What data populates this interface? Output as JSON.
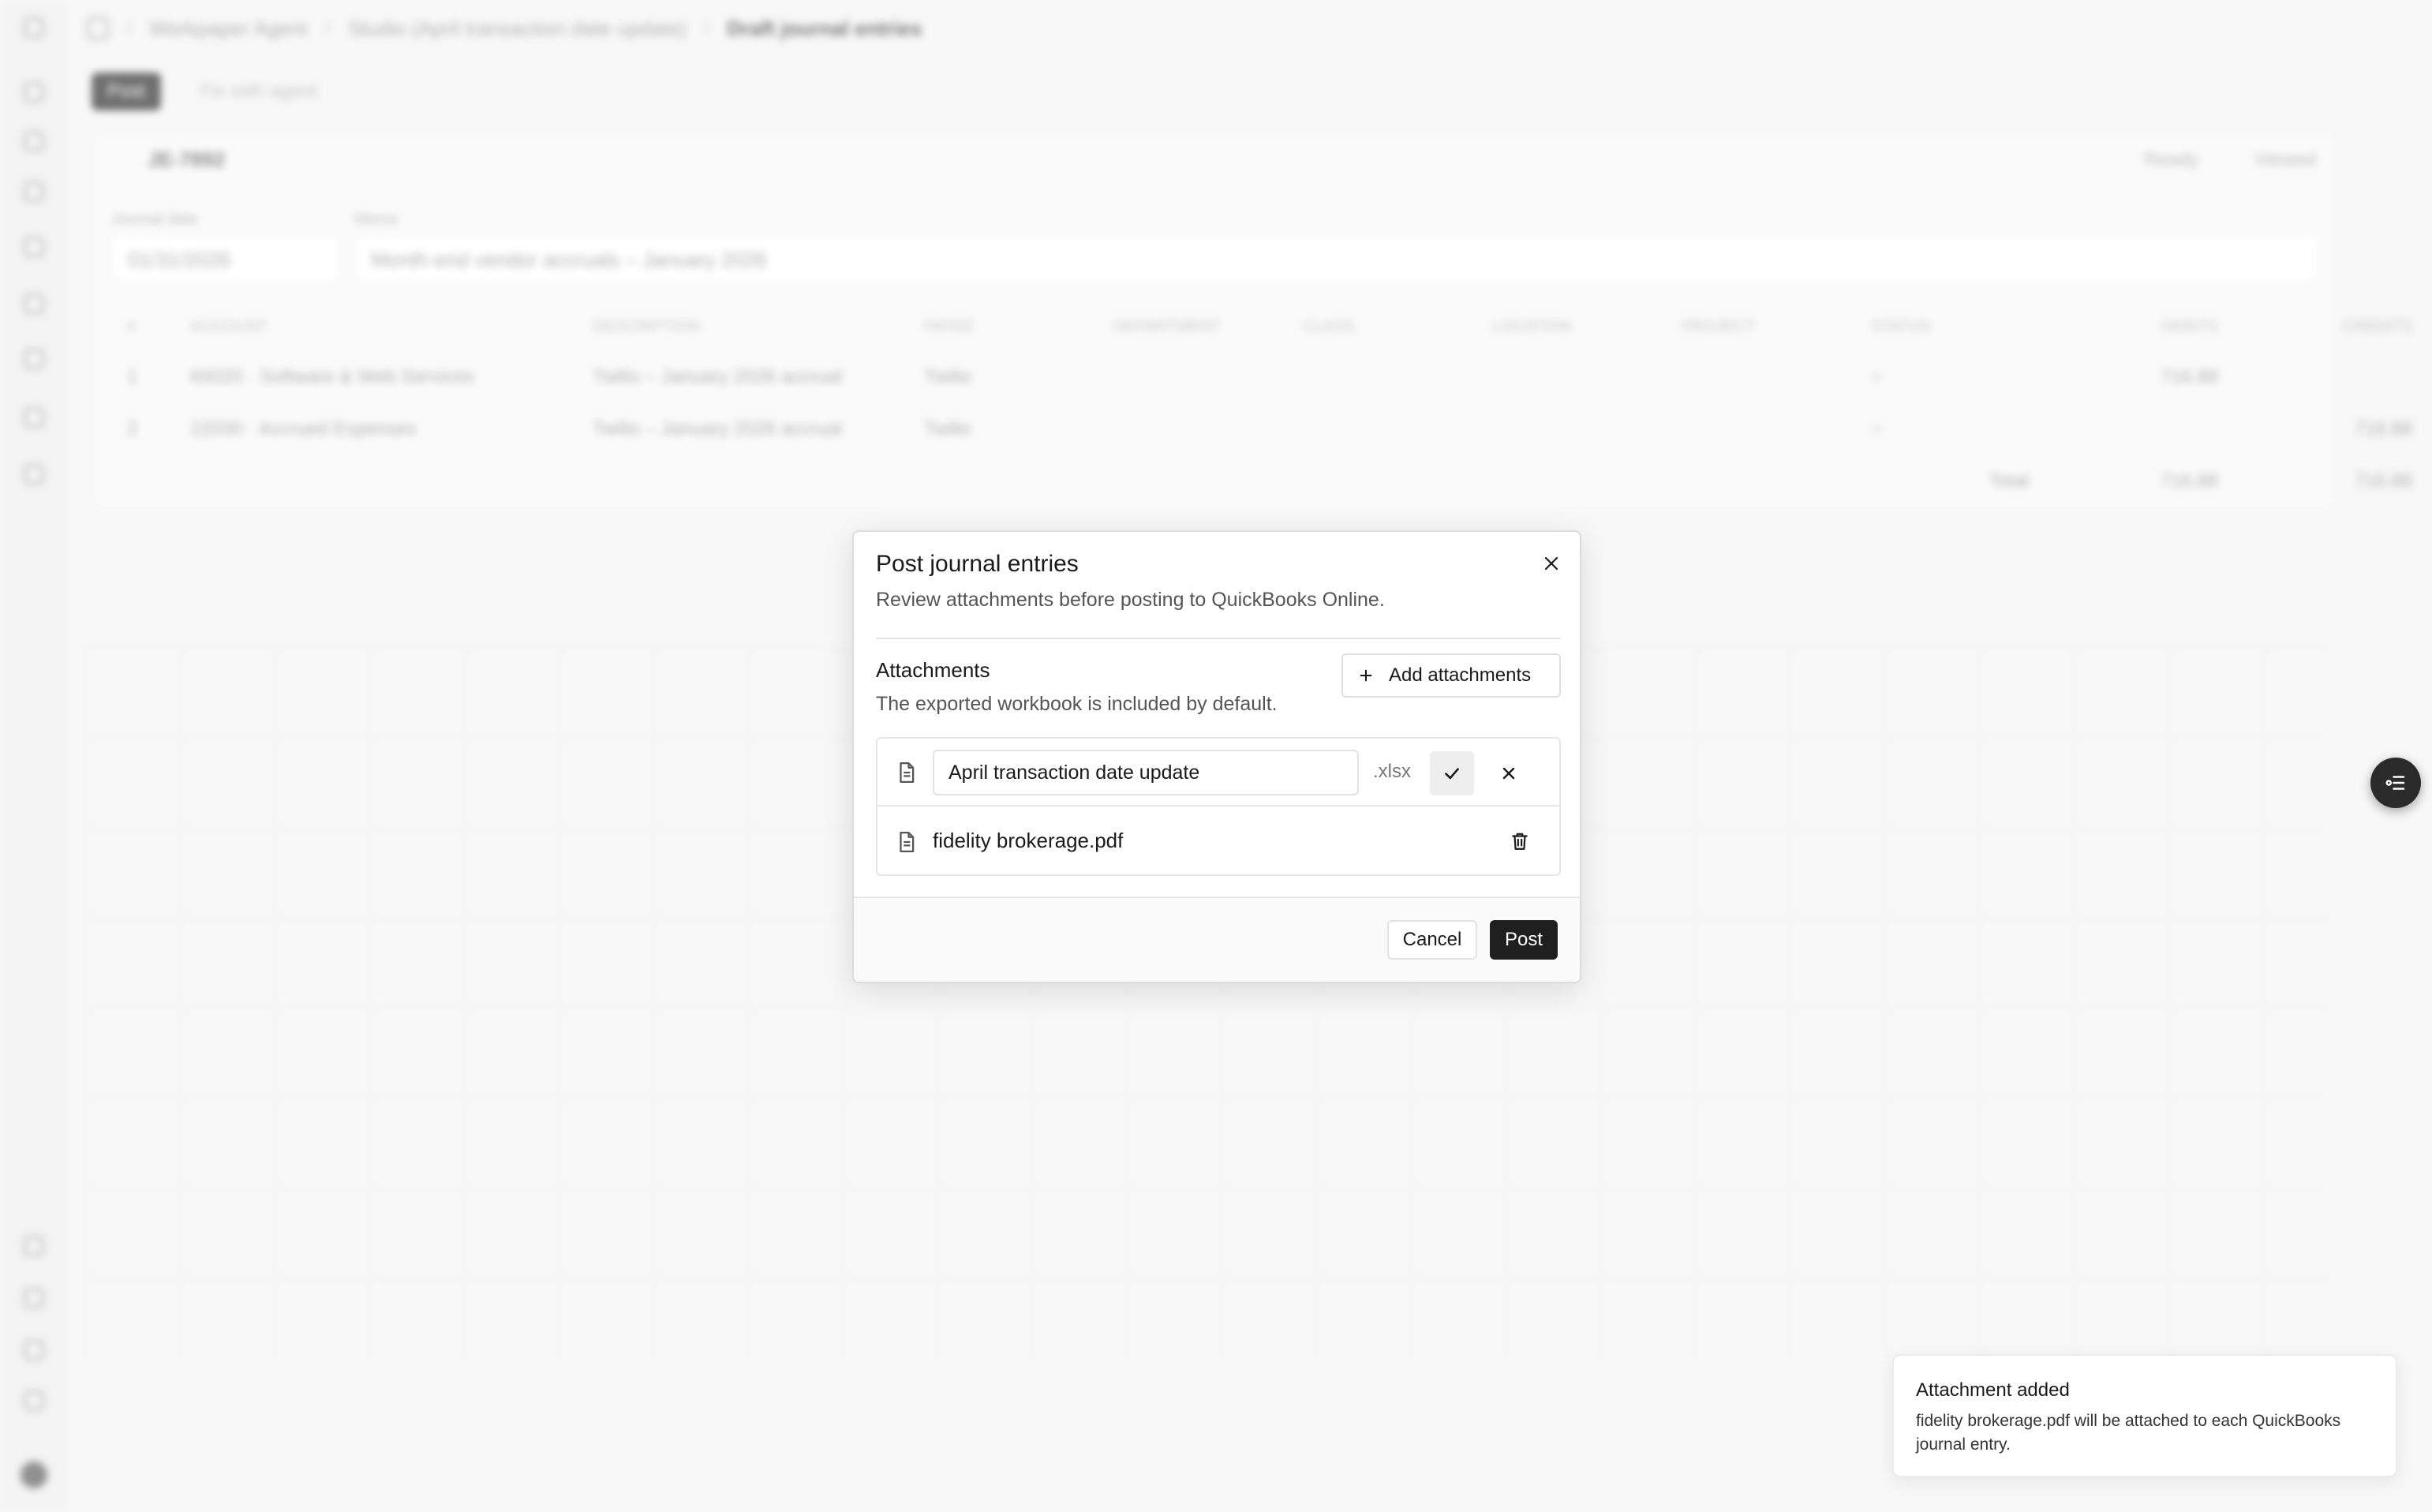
{
  "background": {
    "breadcrumbs": [
      "Workpaper Agent",
      "Studio (April transaction date update)",
      "Draft journal entries"
    ],
    "tabs": [
      "Post",
      "Fix with agent"
    ],
    "entry": {
      "id": "JE-7892",
      "status_ready": "Ready",
      "status_viewed": "Viewed",
      "journal_date_label": "Journal date",
      "journal_date": "01/31/2026",
      "memo_label": "Memo",
      "memo": "Month-end vendor accruals – January 2026"
    },
    "table": {
      "headers": [
        "#",
        "ACCOUNT",
        "DESCRIPTION",
        "PAYEE",
        "DEPARTMENT",
        "CLASS",
        "LOCATION",
        "PROJECT",
        "STATUS",
        "DEBITS",
        "CREDITS"
      ],
      "rows": [
        [
          "1",
          "65020 · Software & Web Services",
          "Twilio – January 2026 accrual",
          "Twilio",
          "",
          "",
          "",
          "",
          "○",
          "716.88",
          ""
        ],
        [
          "2",
          "22030 · Accrued Expenses",
          "Twilio – January 2026 accrual",
          "Twilio",
          "",
          "",
          "",
          "",
          "○",
          "",
          "716.88"
        ]
      ],
      "total_label": "Total",
      "total_debits": "716.88",
      "total_credits": "716.88"
    }
  },
  "modal": {
    "title": "Post journal entries",
    "subtitle": "Review attachments before posting to QuickBooks Online.",
    "attachments_title": "Attachments",
    "attachments_subtitle": "The exported workbook is included by default.",
    "add_attachments_label": "Add attachments",
    "files": [
      {
        "name": "April transaction date update",
        "extension": ".xlsx",
        "editing": true
      },
      {
        "name": "fidelity brokerage.pdf",
        "editing": false
      }
    ],
    "cancel_label": "Cancel",
    "post_label": "Post"
  },
  "toast": {
    "title": "Attachment added",
    "body": "fidelity brokerage.pdf will be attached to each QuickBooks journal entry."
  },
  "icons": {
    "close": "close-icon",
    "add": "plus-icon",
    "file": "file-icon",
    "confirm": "check-icon",
    "cancel_edit": "x-icon",
    "delete": "trash-icon",
    "fab": "task-list-icon"
  },
  "colors": {
    "primary_button": "#1f1f1f",
    "background": "#f4f4f4"
  }
}
